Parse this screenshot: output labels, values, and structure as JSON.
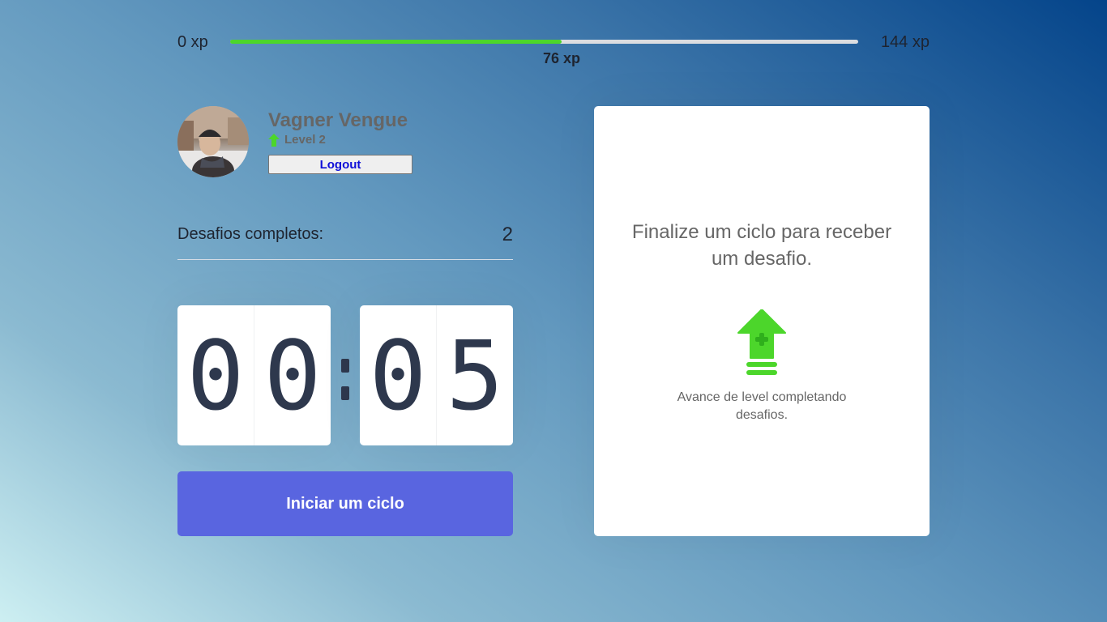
{
  "xp": {
    "min_label": "0 xp",
    "max_label": "144 xp",
    "current_label": "76 xp",
    "current": 76,
    "max": 144
  },
  "profile": {
    "name": "Vagner Vengue",
    "level_label": "Level 2",
    "logout_label": "Logout"
  },
  "completed": {
    "label": "Desafios completos:",
    "count": "2"
  },
  "countdown": {
    "minutes": [
      "0",
      "0"
    ],
    "seconds": [
      "0",
      "5"
    ]
  },
  "start_button_label": "Iniciar um ciclo",
  "challenge": {
    "title": "Finalize um ciclo para receber um desafio.",
    "hint": "Avance de level completando desafios."
  },
  "colors": {
    "accent_blue": "#5965e0",
    "xp_green": "#4cd62b",
    "level_up_green": "#4cd62b"
  },
  "icons": {
    "level": "level-up-arrow-icon",
    "challenge": "level-up-icon"
  }
}
